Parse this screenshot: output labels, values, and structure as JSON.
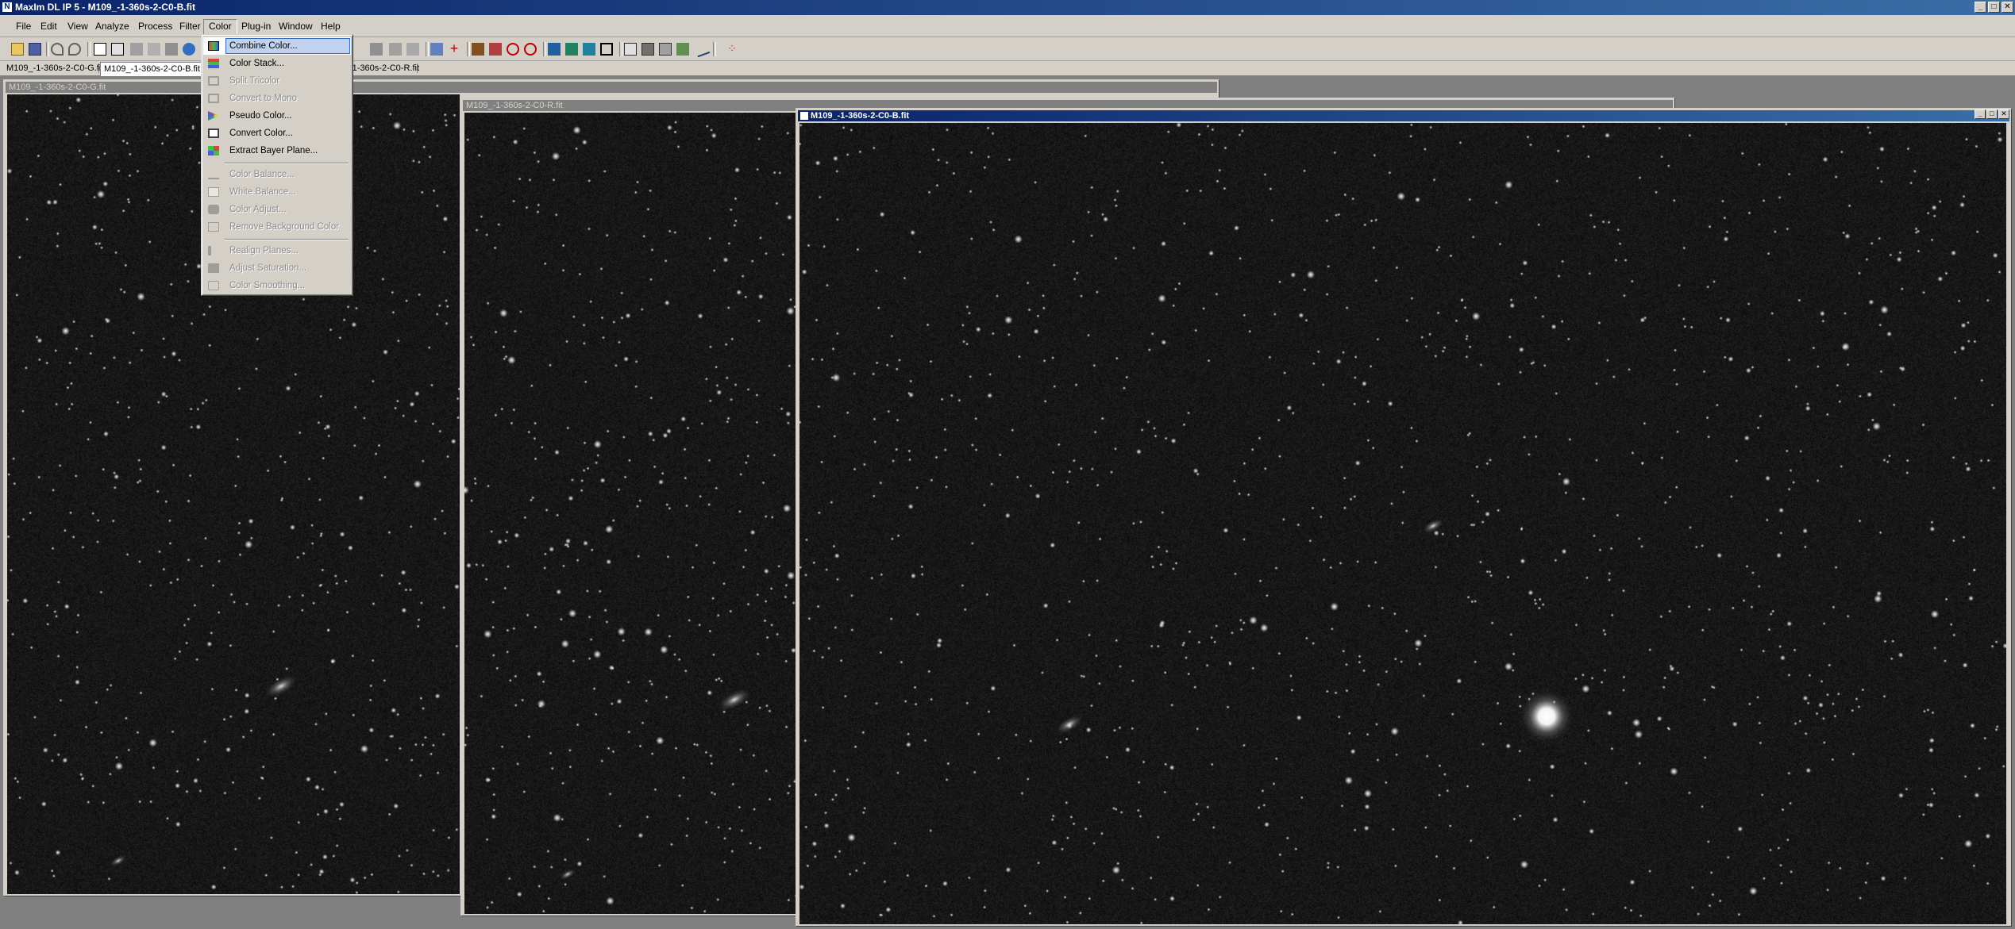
{
  "app": {
    "title": "MaxIm DL IP 5 - M109_-1-360s-2-C0-B.fit"
  },
  "window_buttons": {
    "minimize": "_",
    "maximize": "□",
    "close": "✕"
  },
  "menubar": {
    "items": [
      "File",
      "Edit",
      "View",
      "Analyze",
      "Process",
      "Filter",
      "Color",
      "Plug-in",
      "Window",
      "Help"
    ],
    "active": "Color"
  },
  "tabs": [
    {
      "label": "M109_-1-360s-2-C0-G.fit"
    },
    {
      "label": "M109_-1-360s-2-C0-B.fit"
    },
    {
      "label": "-1-360s-2-C0-R.fit"
    }
  ],
  "color_menu": {
    "items": [
      {
        "label": "Combine Color...",
        "enabled": true,
        "highlighted": true,
        "icon": "combine-color-icon"
      },
      {
        "label": "Color Stack...",
        "enabled": true,
        "icon": "color-stack-icon"
      },
      {
        "label": "Split Tricolor",
        "enabled": false,
        "icon": "split-tricolor-icon"
      },
      {
        "label": "Convert to Mono",
        "enabled": false,
        "icon": "convert-mono-icon"
      },
      {
        "label": "Pseudo Color...",
        "enabled": true,
        "icon": "pseudo-color-icon"
      },
      {
        "label": "Convert Color...",
        "enabled": true,
        "icon": "convert-color-icon"
      },
      {
        "label": "Extract Bayer Plane...",
        "enabled": true,
        "icon": "bayer-plane-icon"
      },
      {
        "label": "Color Balance...",
        "enabled": false,
        "icon": "color-balance-icon"
      },
      {
        "label": "White Balance...",
        "enabled": false,
        "icon": "white-balance-icon"
      },
      {
        "label": "Color Adjust...",
        "enabled": false,
        "icon": "color-adjust-icon"
      },
      {
        "label": "Remove Background Color",
        "enabled": false,
        "icon": "remove-bg-color-icon"
      },
      {
        "label": "Realign Planes...",
        "enabled": false,
        "icon": "realign-planes-icon"
      },
      {
        "label": "Adjust Saturation...",
        "enabled": false,
        "icon": "adjust-saturation-icon"
      },
      {
        "label": "Color Smoothing...",
        "enabled": false,
        "icon": "color-smoothing-icon"
      }
    ]
  },
  "image_windows": [
    {
      "title": "M109_-1-360s-2-C0-G.fit",
      "active": false
    },
    {
      "title": "M109_-1-360s-2-C0-R.fit",
      "active": false
    },
    {
      "title": "M109_-1-360s-2-C0-B.fit",
      "active": true
    }
  ],
  "colors": {
    "title_bar_start": "#0a246a",
    "title_bar_end": "#3a6ea5",
    "chrome": "#d4d0c8",
    "mdi_background": "#808080",
    "sky_background": "#0d0d0d",
    "menu_highlight": "#c1d2ee"
  }
}
